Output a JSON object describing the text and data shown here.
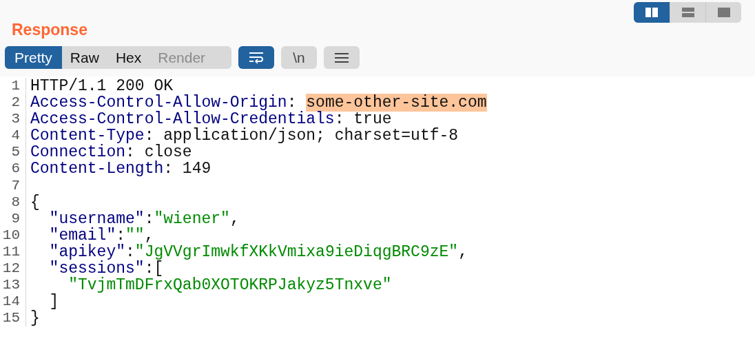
{
  "layout_buttons": [
    {
      "kind": "columns",
      "selected": true
    },
    {
      "kind": "rows",
      "selected": false
    },
    {
      "kind": "single",
      "selected": false
    }
  ],
  "title": "Response",
  "tabs": [
    {
      "label": "Pretty",
      "selected": true,
      "disabled": false
    },
    {
      "label": "Raw",
      "selected": false,
      "disabled": false
    },
    {
      "label": "Hex",
      "selected": false,
      "disabled": false
    },
    {
      "label": "Render",
      "selected": false,
      "disabled": true
    }
  ],
  "tools": [
    {
      "kind": "wrap",
      "on": true
    },
    {
      "kind": "newline",
      "label": "\\n",
      "on": false
    },
    {
      "kind": "menu",
      "on": false
    }
  ],
  "lines": [
    {
      "number": "1",
      "tokens": [
        {
          "kind": "plain",
          "text": "HTTP/1.1 200 OK"
        }
      ]
    },
    {
      "number": "2",
      "tokens": [
        {
          "kind": "name",
          "text": "Access-Control-Allow-Origin"
        },
        {
          "kind": "plain",
          "text": ": "
        },
        {
          "kind": "highlight",
          "text": "some-other-site.com"
        }
      ]
    },
    {
      "number": "3",
      "tokens": [
        {
          "kind": "name",
          "text": "Access-Control-Allow-Credentials"
        },
        {
          "kind": "plain",
          "text": ": true"
        }
      ]
    },
    {
      "number": "4",
      "tokens": [
        {
          "kind": "name",
          "text": "Content-Type"
        },
        {
          "kind": "plain",
          "text": ": application/json; charset=utf-8"
        }
      ]
    },
    {
      "number": "5",
      "tokens": [
        {
          "kind": "name",
          "text": "Connection"
        },
        {
          "kind": "plain",
          "text": ": close"
        }
      ]
    },
    {
      "number": "6",
      "tokens": [
        {
          "kind": "name",
          "text": "Content-Length"
        },
        {
          "kind": "plain",
          "text": ": 149"
        }
      ]
    },
    {
      "number": "7"
    },
    {
      "number": "8",
      "tokens": [
        {
          "kind": "plain",
          "text": "{"
        }
      ]
    },
    {
      "number": "9",
      "tokens": [
        {
          "kind": "name",
          "text": "  \"username\""
        },
        {
          "kind": "plain",
          "text": ":"
        },
        {
          "kind": "string",
          "text": "\"wiener\""
        },
        {
          "kind": "plain",
          "text": ","
        }
      ]
    },
    {
      "number": "10",
      "tokens": [
        {
          "kind": "name",
          "text": "  \"email\""
        },
        {
          "kind": "plain",
          "text": ":"
        },
        {
          "kind": "string",
          "text": "\"\""
        },
        {
          "kind": "plain",
          "text": ","
        }
      ]
    },
    {
      "number": "11",
      "tokens": [
        {
          "kind": "name",
          "text": "  \"apikey\""
        },
        {
          "kind": "plain",
          "text": ":"
        },
        {
          "kind": "string",
          "text": "\"JgVVgrImwkfXKkVmixa9ieDiqgBRC9zE\""
        },
        {
          "kind": "plain",
          "text": ","
        }
      ]
    },
    {
      "number": "12",
      "tokens": [
        {
          "kind": "name",
          "text": "  \"sessions\""
        },
        {
          "kind": "plain",
          "text": ":["
        }
      ]
    },
    {
      "number": "13",
      "tokens": [
        {
          "kind": "string",
          "text": "    \"TvjmTmDFrxQab0XOTOKRPJakyz5Tnxve\""
        }
      ]
    },
    {
      "number": "14",
      "tokens": [
        {
          "kind": "plain",
          "text": "  ]"
        }
      ]
    },
    {
      "number": "15",
      "tokens": [
        {
          "kind": "plain",
          "text": "}"
        }
      ]
    }
  ]
}
